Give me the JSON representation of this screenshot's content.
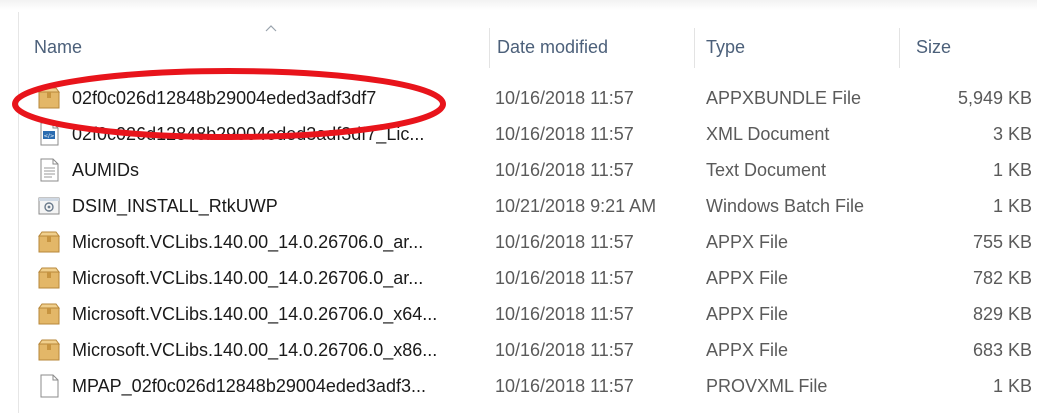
{
  "columns": {
    "name": "Name",
    "date": "Date modified",
    "type": "Type",
    "size": "Size"
  },
  "files": [
    {
      "name": "02f0c026d12848b29004eded3adf3df7",
      "date": "10/16/2018 11:57",
      "type": "APPXBUNDLE File",
      "size": "5,949 KB",
      "icon": "package-icon"
    },
    {
      "name": "02f0c026d12848b29004eded3adf3df7_Lic...",
      "date": "10/16/2018 11:57",
      "type": "XML Document",
      "size": "3 KB",
      "icon": "xml-document-icon"
    },
    {
      "name": "AUMIDs",
      "date": "10/16/2018 11:57",
      "type": "Text Document",
      "size": "1 KB",
      "icon": "text-document-icon"
    },
    {
      "name": "DSIM_INSTALL_RtkUWP",
      "date": "10/21/2018 9:21 AM",
      "type": "Windows Batch File",
      "size": "1 KB",
      "icon": "batch-file-icon"
    },
    {
      "name": "Microsoft.VCLibs.140.00_14.0.26706.0_ar...",
      "date": "10/16/2018 11:57",
      "type": "APPX File",
      "size": "755 KB",
      "icon": "package-icon"
    },
    {
      "name": "Microsoft.VCLibs.140.00_14.0.26706.0_ar...",
      "date": "10/16/2018 11:57",
      "type": "APPX File",
      "size": "782 KB",
      "icon": "package-icon"
    },
    {
      "name": "Microsoft.VCLibs.140.00_14.0.26706.0_x64...",
      "date": "10/16/2018 11:57",
      "type": "APPX File",
      "size": "829 KB",
      "icon": "package-icon"
    },
    {
      "name": "Microsoft.VCLibs.140.00_14.0.26706.0_x86...",
      "date": "10/16/2018 11:57",
      "type": "APPX File",
      "size": "683 KB",
      "icon": "package-icon"
    },
    {
      "name": "MPAP_02f0c026d12848b29004eded3adf3...",
      "date": "10/16/2018 11:57",
      "type": "PROVXML File",
      "size": "1 KB",
      "icon": "blank-document-icon"
    }
  ],
  "colors": {
    "header_text": "#4c607a",
    "annotation": "#e8141b",
    "package_fill": "#e3b768"
  }
}
